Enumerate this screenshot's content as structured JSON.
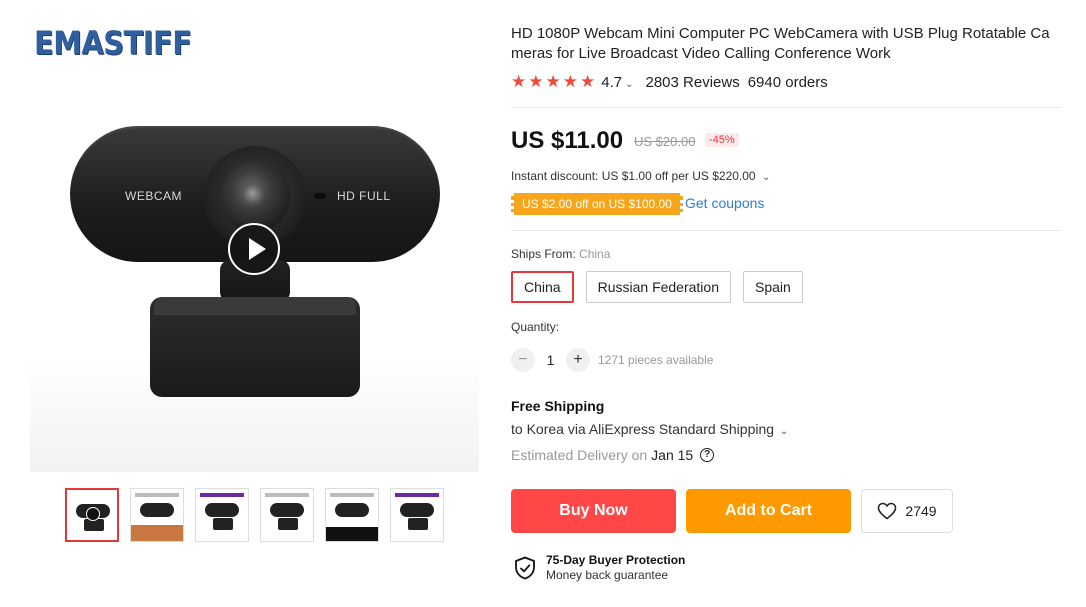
{
  "store": {
    "logo_text": "EMASTIFF"
  },
  "gallery": {
    "main_labels": {
      "left": "WEBCAM",
      "right": "HD FULL"
    },
    "thumbnails": [
      "video",
      "floor",
      "purple-banner",
      "gray-banner",
      "dark-banner",
      "purple-banner-2"
    ]
  },
  "product": {
    "title": "HD 1080P Webcam Mini Computer PC WebCamera with USB Plug Rotatable Cameras for Live Broadcast Video Calling Conference Work",
    "rating": "4.7",
    "reviews": "2803 Reviews",
    "orders": "6940 orders"
  },
  "pricing": {
    "price": "US $11.00",
    "old_price": "US $20.00",
    "discount": "-45%",
    "instant_discount": "Instant discount: US $1.00 off per US $220.00",
    "coupon": "US $2.00 off on US $100.00",
    "get_coupons": "Get coupons"
  },
  "shipping_from": {
    "label": "Ships From:",
    "value": "China",
    "options": [
      "China",
      "Russian Federation",
      "Spain"
    ]
  },
  "quantity": {
    "label": "Quantity:",
    "value": "1",
    "minus": "−",
    "plus": "+",
    "available": "1271 pieces available"
  },
  "delivery": {
    "free_shipping": "Free Shipping",
    "via": "to Korea via AliExpress Standard Shipping",
    "estimated_label": "Estimated Delivery on",
    "estimated_date": "Jan 15"
  },
  "actions": {
    "buy_now": "Buy Now",
    "add_to_cart": "Add to Cart",
    "wishlist_count": "2749"
  },
  "protection": {
    "title": "75-Day Buyer Protection",
    "subtitle": "Money back guarantee"
  },
  "colors": {
    "accent_red": "#ff4747",
    "accent_orange": "#ff9900",
    "star": "#f1493e",
    "link": "#2d7ed6"
  }
}
